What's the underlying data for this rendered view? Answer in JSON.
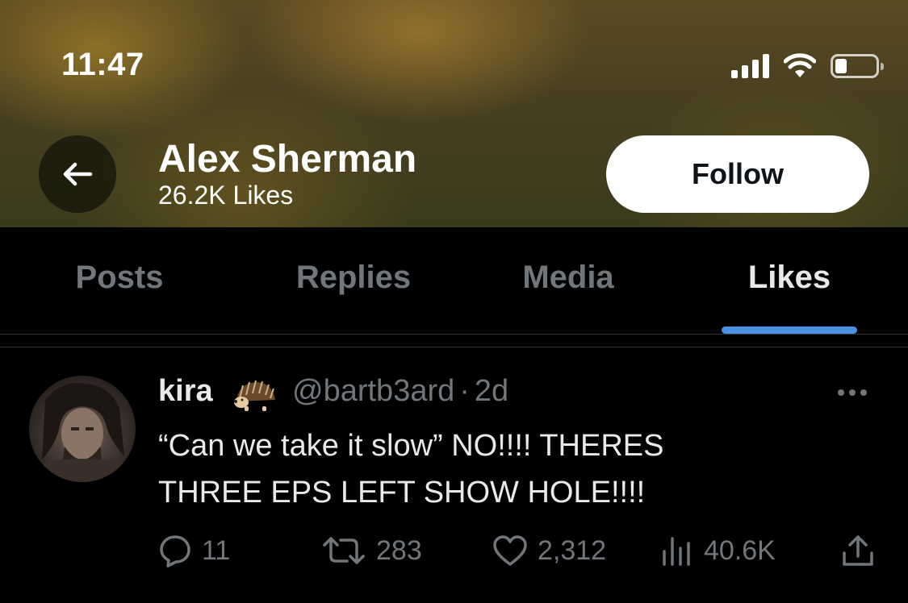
{
  "status_bar": {
    "time": "11:47"
  },
  "header": {
    "back_icon": "arrow-left-icon",
    "name": "Alex Sherman",
    "likes": "26.2K Likes",
    "follow_label": "Follow"
  },
  "tabs": [
    {
      "label": "Posts",
      "active": false
    },
    {
      "label": "Replies",
      "active": false
    },
    {
      "label": "Media",
      "active": false
    },
    {
      "label": "Likes",
      "active": true
    }
  ],
  "tab_indicator_color": "#4a90e2",
  "tweet": {
    "display_name": "kira",
    "name_emoji": "hedgehog-emoji",
    "handle": "@bartb3ard",
    "separator": "·",
    "time": "2d",
    "text": "“Can we take it slow” NO!!!! THERES\nTHREE EPS LEFT SHOW HOLE!!!!",
    "actions": {
      "replies": "11",
      "reposts": "283",
      "likes": "2,312",
      "views": "40.6K"
    }
  }
}
